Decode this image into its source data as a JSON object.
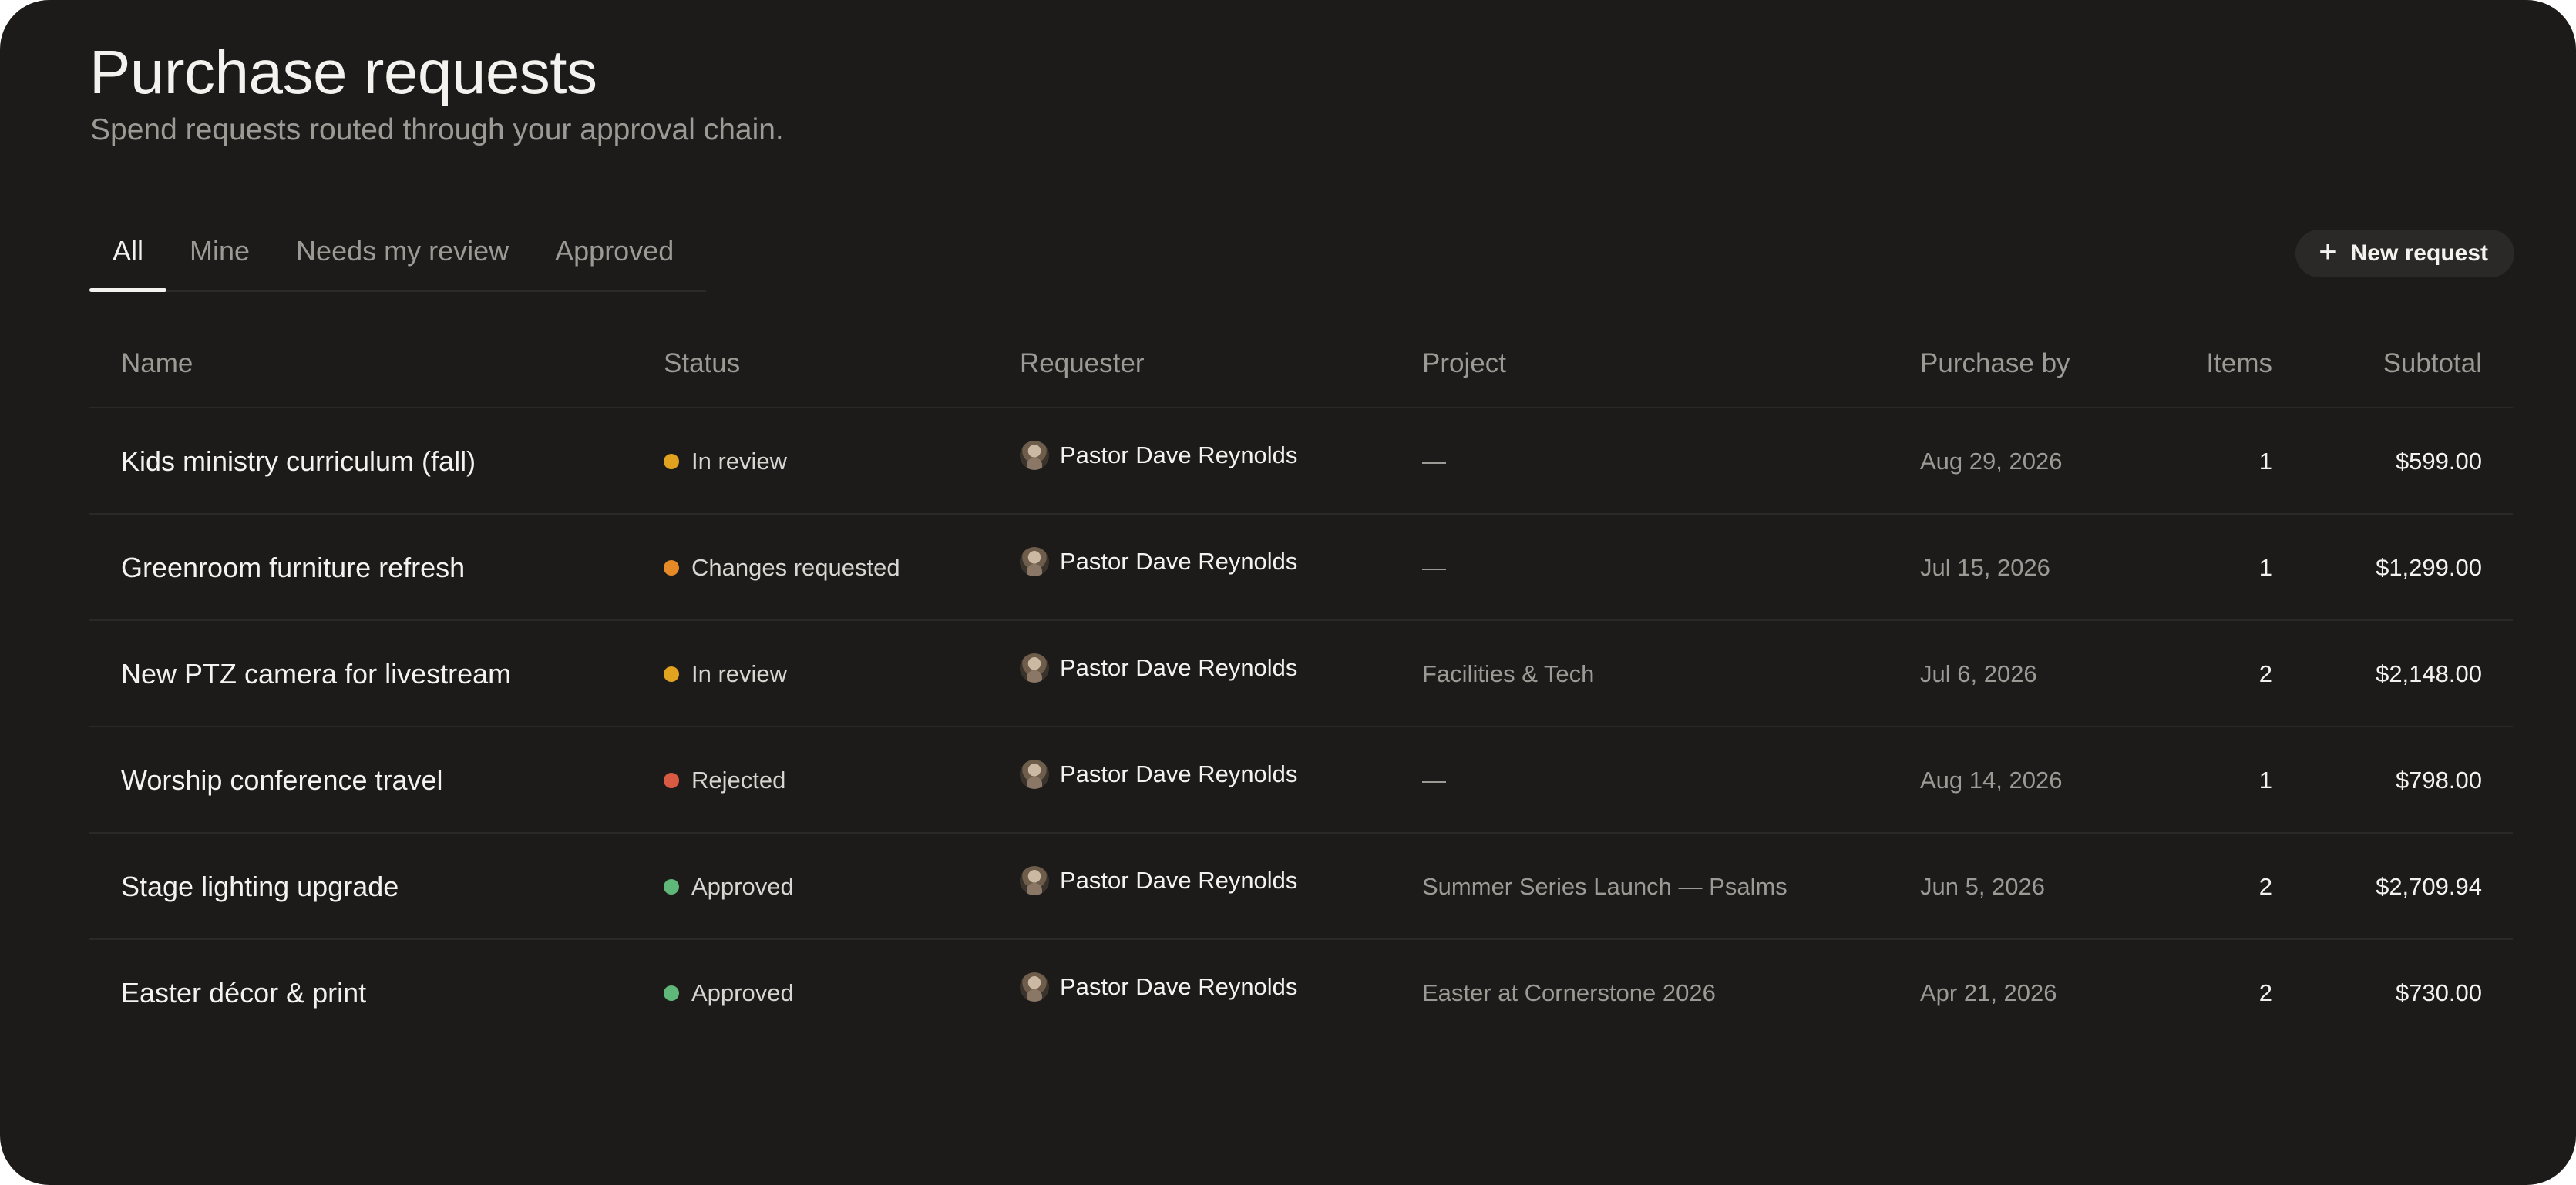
{
  "header": {
    "title": "Purchase requests",
    "subtitle": "Spend requests routed through your approval chain."
  },
  "tabs": [
    {
      "label": "All",
      "active": true
    },
    {
      "label": "Mine",
      "active": false
    },
    {
      "label": "Needs my review",
      "active": false
    },
    {
      "label": "Approved",
      "active": false
    }
  ],
  "actions": {
    "new_request_label": "New request",
    "new_request_icon": "plus-icon"
  },
  "colors": {
    "background": "#1c1b1a",
    "status_in_review": "#e0a21f",
    "status_changes_requested": "#e58a26",
    "status_rejected": "#d95a42",
    "status_approved": "#5fb87a"
  },
  "table": {
    "columns": {
      "name": "Name",
      "status": "Status",
      "requester": "Requester",
      "project": "Project",
      "purchase_by": "Purchase by",
      "items": "Items",
      "subtotal": "Subtotal"
    },
    "rows": [
      {
        "name": "Kids ministry curriculum (fall)",
        "status": "In review",
        "status_color": "#e0a21f",
        "requester": "Pastor Dave Reynolds",
        "project": "—",
        "purchase_by": "Aug 29, 2026",
        "items": "1",
        "subtotal": "$599.00"
      },
      {
        "name": "Greenroom furniture refresh",
        "status": "Changes requested",
        "status_color": "#e58a26",
        "requester": "Pastor Dave Reynolds",
        "project": "—",
        "purchase_by": "Jul 15, 2026",
        "items": "1",
        "subtotal": "$1,299.00"
      },
      {
        "name": "New PTZ camera for livestream",
        "status": "In review",
        "status_color": "#e0a21f",
        "requester": "Pastor Dave Reynolds",
        "project": "Facilities & Tech",
        "purchase_by": "Jul 6, 2026",
        "items": "2",
        "subtotal": "$2,148.00"
      },
      {
        "name": "Worship conference travel",
        "status": "Rejected",
        "status_color": "#d95a42",
        "requester": "Pastor Dave Reynolds",
        "project": "—",
        "purchase_by": "Aug 14, 2026",
        "items": "1",
        "subtotal": "$798.00"
      },
      {
        "name": "Stage lighting upgrade",
        "status": "Approved",
        "status_color": "#5fb87a",
        "requester": "Pastor Dave Reynolds",
        "project": "Summer Series Launch — Psalms",
        "purchase_by": "Jun 5, 2026",
        "items": "2",
        "subtotal": "$2,709.94"
      },
      {
        "name": "Easter décor & print",
        "status": "Approved",
        "status_color": "#5fb87a",
        "requester": "Pastor Dave Reynolds",
        "project": "Easter at Cornerstone 2026",
        "purchase_by": "Apr 21, 2026",
        "items": "2",
        "subtotal": "$730.00"
      }
    ]
  }
}
